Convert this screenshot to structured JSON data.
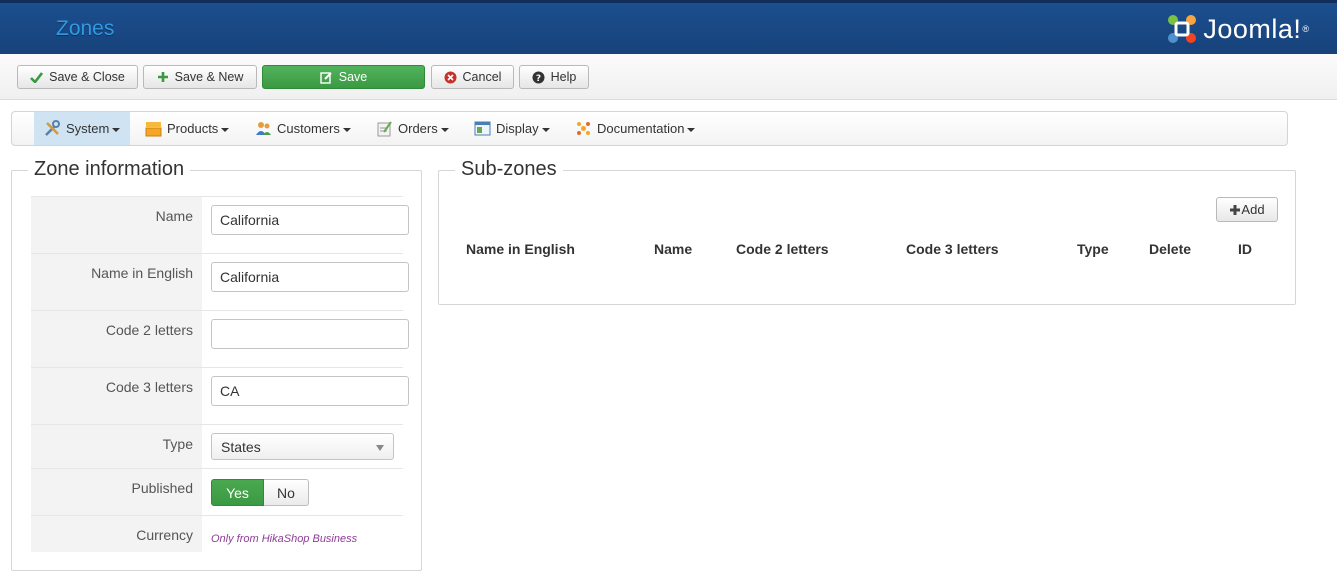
{
  "header": {
    "title": "Zones",
    "logo_text": "Joomla!",
    "logo_mark": "®"
  },
  "toolbar": {
    "save_close": "Save & Close",
    "save_new": "Save & New",
    "save": "Save",
    "cancel": "Cancel",
    "help": "Help"
  },
  "menu": {
    "items": [
      {
        "label": "System",
        "icon": "tools-icon"
      },
      {
        "label": "Products",
        "icon": "products-icon"
      },
      {
        "label": "Customers",
        "icon": "customers-icon"
      },
      {
        "label": "Orders",
        "icon": "orders-icon"
      },
      {
        "label": "Display",
        "icon": "display-icon"
      },
      {
        "label": "Documentation",
        "icon": "documentation-icon"
      }
    ]
  },
  "zone_info": {
    "legend": "Zone information",
    "fields": {
      "name": {
        "label": "Name",
        "value": "California"
      },
      "name_english": {
        "label": "Name in English",
        "value": "California"
      },
      "code2": {
        "label": "Code 2 letters",
        "value": ""
      },
      "code3": {
        "label": "Code 3 letters",
        "value": "CA"
      },
      "type": {
        "label": "Type",
        "value": "States"
      },
      "published": {
        "label": "Published",
        "yes": "Yes",
        "no": "No",
        "selected": "Yes"
      },
      "currency": {
        "label": "Currency",
        "note": "Only from HikaShop Business"
      }
    }
  },
  "sub_zones": {
    "legend": "Sub-zones",
    "add_label": "Add",
    "columns": [
      "Name in English",
      "Name",
      "Code 2 letters",
      "Code 3 letters",
      "Type",
      "Delete",
      "ID"
    ]
  },
  "colors": {
    "header_bg": "#17427a",
    "title": "#2f9ae0",
    "primary_green": "#3a9a43",
    "menu_active": "#cfe3f3",
    "note_purple": "#8f3b9a"
  }
}
